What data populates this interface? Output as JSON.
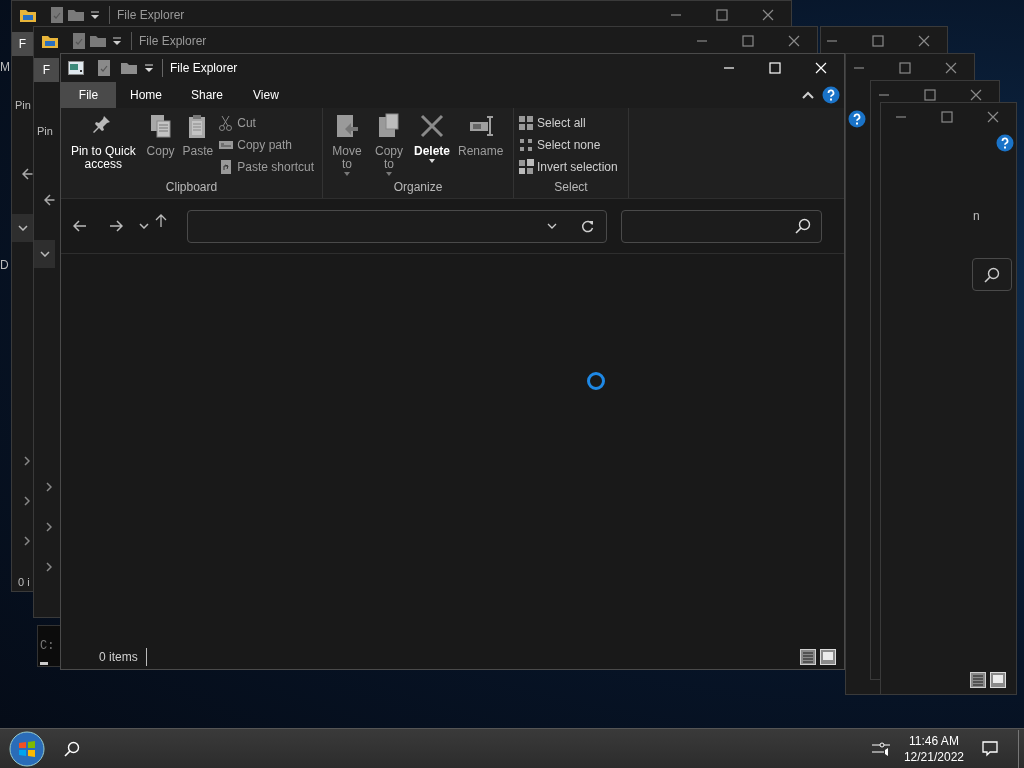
{
  "desktop": {
    "fragments": [
      {
        "text": "M"
      },
      {
        "text": "D"
      },
      {
        "text": "n"
      },
      {
        "text": "C:"
      }
    ],
    "back_windows": [
      {
        "title": "File Explorer",
        "tab": "F",
        "ribbon_text": "Pin",
        "status": "0 i"
      },
      {
        "title": "File Explorer",
        "tab": "F",
        "ribbon_text": "Pin"
      }
    ]
  },
  "window": {
    "title": "File Explorer",
    "tabs": [
      {
        "label": "File",
        "selected": true
      },
      {
        "label": "Home",
        "selected": false
      },
      {
        "label": "Share",
        "selected": false
      },
      {
        "label": "View",
        "selected": false
      }
    ],
    "ribbon": [
      {
        "label": "Clipboard",
        "large": [
          {
            "label": "Pin to Quick access",
            "disabled": false,
            "dropdown": false
          },
          {
            "label": "Copy",
            "disabled": true,
            "dropdown": false
          },
          {
            "label": "Paste",
            "disabled": true,
            "dropdown": false
          }
        ],
        "small": [
          {
            "label": "Cut",
            "disabled": true
          },
          {
            "label": "Copy path",
            "disabled": true
          },
          {
            "label": "Paste shortcut",
            "disabled": true
          }
        ]
      },
      {
        "label": "Organize",
        "large": [
          {
            "label": "Move to",
            "disabled": true,
            "dropdown": true
          },
          {
            "label": "Copy to",
            "disabled": true,
            "dropdown": true
          },
          {
            "label": "Delete",
            "disabled": false,
            "dropdown": true
          },
          {
            "label": "Rename",
            "disabled": true,
            "dropdown": false
          }
        ]
      },
      {
        "label": "Select",
        "small": [
          {
            "label": "Select all",
            "disabled": false
          },
          {
            "label": "Select none",
            "disabled": false
          },
          {
            "label": "Invert selection",
            "disabled": false
          }
        ]
      }
    ],
    "loading": true,
    "status": "0 items"
  },
  "taskbar": {
    "time": "11:46 AM",
    "date": "12/21/2022"
  }
}
